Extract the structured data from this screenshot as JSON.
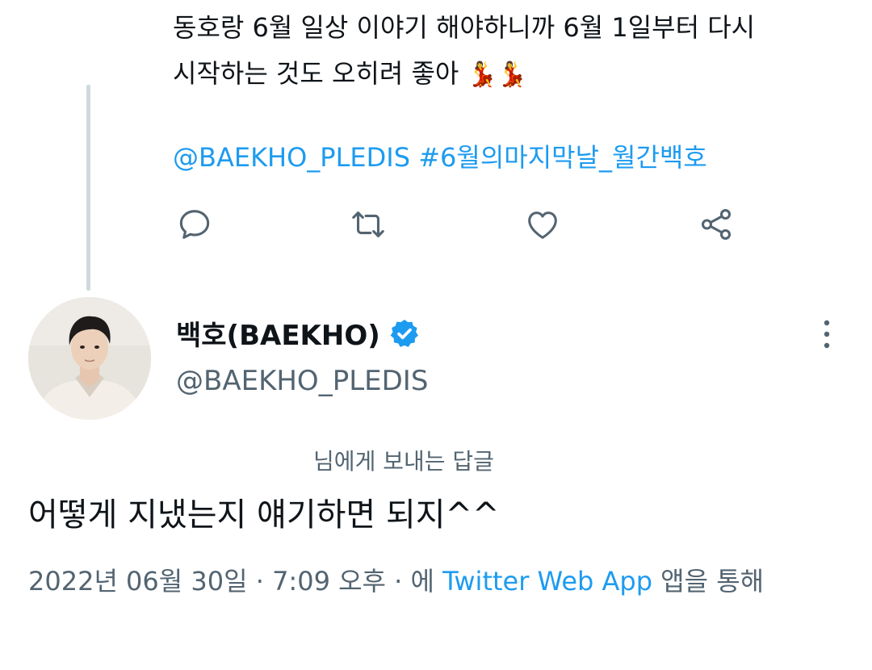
{
  "previous_tweet": {
    "text_line1": "동호랑 6월 일상 이야기 해야하니까 6월 1일부터 다시",
    "text_line2": "시작하는 것도 오히려 좋아",
    "emojis": "💃💃",
    "mention": "@BAEKHO_PLEDIS",
    "hashtag": "#6월의마지막날_월간백호"
  },
  "actions": {
    "reply_icon": "comment-icon",
    "retweet_icon": "retweet-icon",
    "like_icon": "heart-icon",
    "share_icon": "share-icon"
  },
  "tweet": {
    "display_name": "백호(BAEKHO)",
    "handle": "@BAEKHO_PLEDIS",
    "reply_to_text": "님에게 보내는 답글",
    "text": "어떻게 지냈는지 얘기하면 되지^^",
    "date": "2022년 06월 30일",
    "separator": "·",
    "time": "7:09 오후",
    "via_prefix": "에",
    "app_name": "Twitter Web App",
    "via_suffix": "앱을 통해"
  },
  "colors": {
    "link": "#1d9bf0",
    "verified": "#1d9bf0",
    "secondary_text": "#536471",
    "thread_line": "#cfd9de"
  }
}
